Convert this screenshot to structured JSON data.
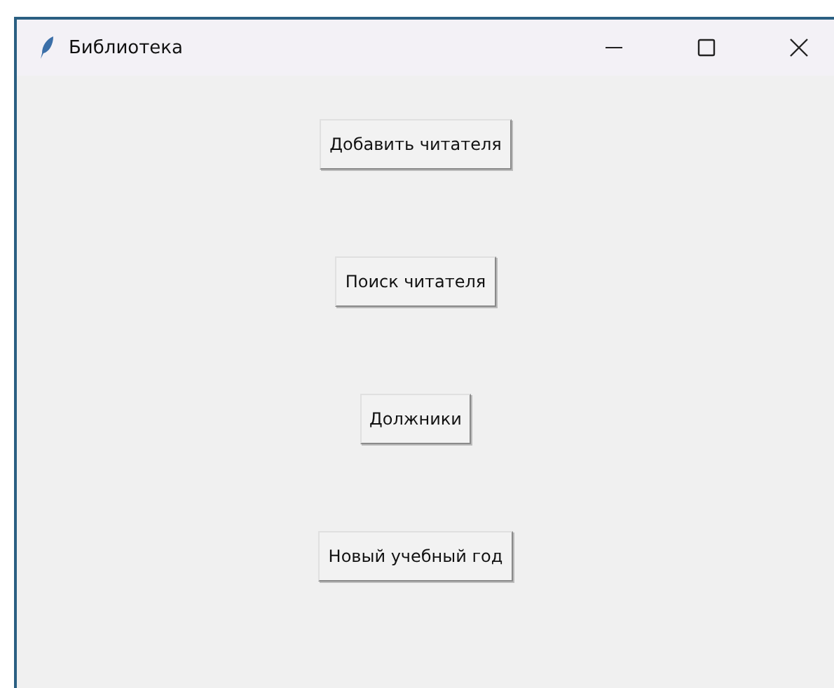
{
  "window": {
    "title": "Библиотека"
  },
  "buttons": [
    "Добавить читателя",
    "Поиск читателя",
    "Должники",
    "Новый учебный год"
  ]
}
